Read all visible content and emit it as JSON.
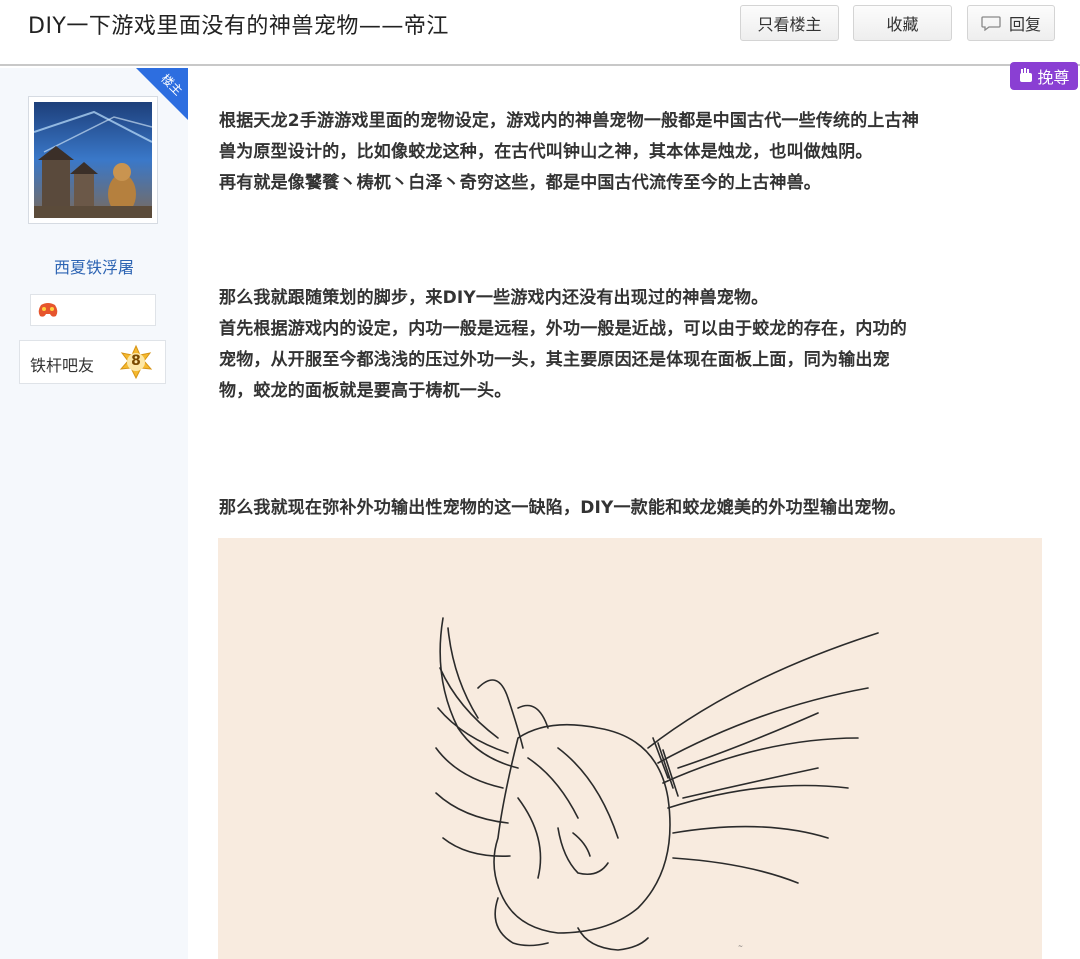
{
  "header": {
    "title": "DIY一下游戏里面没有的神兽宠物——帝江",
    "btn_only_op": "只看楼主",
    "btn_favorite": "收藏",
    "btn_reply": "回复"
  },
  "sidebar": {
    "op_tag": "楼主",
    "username": "西夏铁浮屠",
    "level_title": "铁杆吧友",
    "level_number": "8"
  },
  "recommend": {
    "label": "挽尊"
  },
  "post": {
    "lines": [
      "根据天龙2手游游戏里面的宠物设定，游戏内的神兽宠物一般都是中国古代一些传统的上古神",
      "兽为原型设计的，比如像蛟龙这种，在古代叫钟山之神，其本体是烛龙，也叫做烛阴。",
      "再有就是像饕餮丶梼杌丶白泽丶奇穷这些，都是中国古代流传至今的上古神兽。",
      "那么我就跟随策划的脚步，来DIY一些游戏内还没有出现过的神兽宠物。",
      "首先根据游戏内的设定，内功一般是远程，外功一般是近战，可以由于蛟龙的存在，内功的",
      "宠物，从开服至今都浅浅的压过外功一头，其主要原因还是体现在面板上面，同为输出宠",
      "物，蛟龙的面板就是要高于梼杌一头。",
      "那么我就现在弥补外功输出性宠物的这一缺陷，DIY一款能和蛟龙媲美的外功型输出宠物。"
    ]
  },
  "colors": {
    "accent_blue": "#2d6ee0",
    "username_blue": "#2d64b3",
    "recommend_purple": "#8a3fd3",
    "image_bg": "#f8ebdf"
  }
}
